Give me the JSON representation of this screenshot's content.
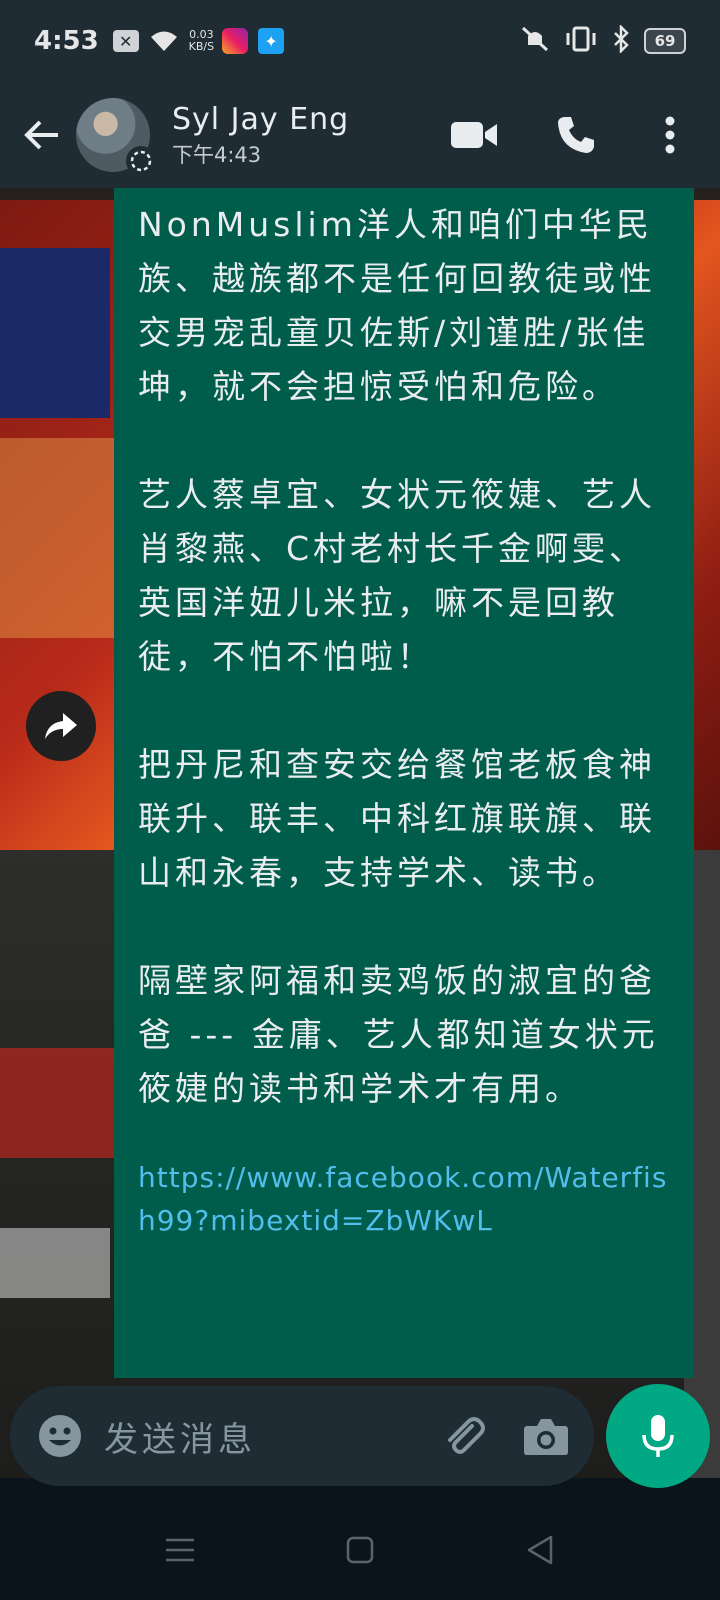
{
  "status_bar": {
    "time": "4:53",
    "net_speed_value": "0.03",
    "net_speed_unit": "KB/S",
    "battery": "69"
  },
  "header": {
    "contact_name": "Syl Jay Eng",
    "last_seen": "下午4:43"
  },
  "message": {
    "paragraphs": [
      "NonMuslim洋人和咱们中华民族、越族都不是任何回教徒或性交男宠乱童贝佐斯/刘谨胜/张佳坤，就不会担惊受怕和危险。",
      "艺人蔡卓宜、女状元筱婕、艺人肖黎燕、C村老村长千金啊雯、英国洋妞儿米拉，嘛不是回教徒，不怕不怕啦！",
      "把丹尼和查安交给餐馆老板食神联升、联丰、中科红旗联旗、联山和永春，支持学术、读书。",
      "隔壁家阿福和卖鸡饭的淑宜的爸爸 --- 金庸、艺人都知道女状元筱婕的读书和学术才有用。"
    ],
    "link": "https://www.facebook.com/Waterfish99?mibextid=ZbWKwL"
  },
  "input": {
    "placeholder": "发送消息"
  },
  "colors": {
    "bubble": "#005c4b",
    "header": "#1f2c34",
    "accent": "#00a884",
    "link": "#53bdeb"
  },
  "icons": [
    "back-arrow-icon",
    "video-call-icon",
    "phone-icon",
    "more-icon",
    "forward-icon",
    "emoji-icon",
    "attach-icon",
    "camera-icon",
    "mic-icon",
    "nav-menu-icon",
    "nav-home-icon",
    "nav-back-icon"
  ]
}
